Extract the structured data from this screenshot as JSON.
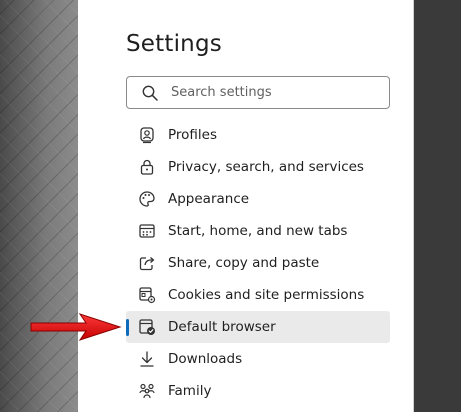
{
  "settings": {
    "title": "Settings",
    "search": {
      "placeholder": "Search settings",
      "value": ""
    },
    "nav_items": [
      {
        "label": "Profiles",
        "icon": "profile-icon",
        "active": false
      },
      {
        "label": "Privacy, search, and services",
        "icon": "lock-icon",
        "active": false
      },
      {
        "label": "Appearance",
        "icon": "palette-icon",
        "active": false
      },
      {
        "label": "Start, home, and new tabs",
        "icon": "new-tab-icon",
        "active": false
      },
      {
        "label": "Share, copy and paste",
        "icon": "share-icon",
        "active": false
      },
      {
        "label": "Cookies and site permissions",
        "icon": "cookie-settings-icon",
        "active": false
      },
      {
        "label": "Default browser",
        "icon": "default-browser-icon",
        "active": true
      },
      {
        "label": "Downloads",
        "icon": "download-icon",
        "active": false
      },
      {
        "label": "Family",
        "icon": "family-icon",
        "active": false
      }
    ]
  },
  "colors": {
    "accent": "#0f6cbd",
    "annotation_arrow": "#e81c1c",
    "active_row": "#eaeaea"
  }
}
